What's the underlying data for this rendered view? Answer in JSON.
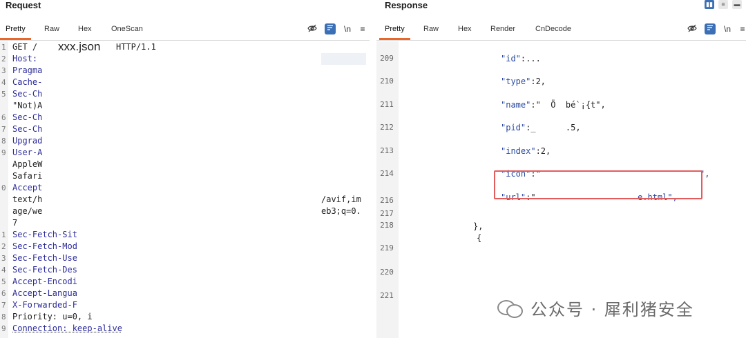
{
  "request": {
    "title": "Request",
    "tabs": [
      "Pretty",
      "Raw",
      "Hex",
      "OneScan"
    ],
    "line_numbers": [
      "1",
      "2",
      "3",
      "4",
      "5",
      "",
      "6",
      "7",
      "8",
      "9",
      "",
      "",
      "0",
      "",
      "",
      "",
      "1",
      "2",
      "3",
      "4",
      "5",
      "6",
      "7",
      "8",
      "9"
    ],
    "lines": [
      {
        "text": "GET /",
        "kind": "val"
      },
      {
        "text": "Host:",
        "kind": "hdr"
      },
      {
        "text": "Pragma",
        "kind": "hdr"
      },
      {
        "text": "Cache-",
        "kind": "hdr"
      },
      {
        "text": "Sec-Ch",
        "kind": "hdr"
      },
      {
        "text": "\"Not)A",
        "kind": "val"
      },
      {
        "text": "Sec-Ch",
        "kind": "hdr"
      },
      {
        "text": "Sec-Ch",
        "kind": "hdr"
      },
      {
        "text": "Upgrad",
        "kind": "hdr"
      },
      {
        "text": "User-A",
        "kind": "hdr"
      },
      {
        "text": "AppleW",
        "kind": "val"
      },
      {
        "text": "Safari",
        "kind": "val"
      },
      {
        "text": "Accept",
        "kind": "hdr"
      },
      {
        "text": "text/h",
        "kind": "val"
      },
      {
        "text": "age/we",
        "kind": "val"
      },
      {
        "text": "7",
        "kind": "val"
      },
      {
        "text": "Sec-Fetch-Sit",
        "kind": "hdr"
      },
      {
        "text": "Sec-Fetch-Mod",
        "kind": "hdr"
      },
      {
        "text": "Sec-Fetch-Use",
        "kind": "hdr"
      },
      {
        "text": "Sec-Fetch-Des",
        "kind": "hdr"
      },
      {
        "text": "Accept-Encodi",
        "kind": "hdr"
      },
      {
        "text": "Accept-Langua",
        "kind": "hdr"
      },
      {
        "text": "X-Forwarded-F",
        "kind": "hdr"
      },
      {
        "text": "Priority: u=0, i",
        "kind": "val"
      },
      {
        "text": "Connection: keep-alive",
        "kind": "hdr"
      }
    ],
    "filename": "xxx.json",
    "http_version": "HTTP/1.1",
    "accept_tail_1": "/avif,im",
    "accept_tail_2": "eb3;q=0."
  },
  "response": {
    "title": "Response",
    "tabs": [
      "Pretty",
      "Raw",
      "Hex",
      "Render",
      "CnDecode"
    ],
    "rows": [
      {
        "ln": "209",
        "key": "\"id\"",
        "rest": ":..."
      },
      {
        "ln": "210",
        "key": "\"type\"",
        "rest": ":2,"
      },
      {
        "ln": "211",
        "key": "\"name\"",
        "rest": ":\"  Ö  bé`¡{t\","
      },
      {
        "ln": "212",
        "key": "\"pid\"",
        "rest": ":_      .5,"
      },
      {
        "ln": "213",
        "key": "\"index\"",
        "rest": ":2,"
      },
      {
        "ln": "214",
        "key": "\"icon\"",
        "rest": ":\"",
        "tail": "\","
      },
      {
        "ln": "",
        "key": "\"url\"",
        "rest": ":\"",
        "tail": "e.html\","
      },
      {
        "ln": "216",
        "key": "",
        "rest": ""
      },
      {
        "ln": "217",
        "key": "",
        "rest": "},"
      },
      {
        "ln": "218",
        "key": "",
        "rest": "{"
      },
      {
        "ln": "219",
        "key": "",
        "rest": ""
      },
      {
        "ln": "220",
        "key": "",
        "rest": ""
      },
      {
        "ln": "221",
        "key": "",
        "rest": ""
      }
    ]
  },
  "watermark": "公众号 · 犀利猪安全",
  "icons": {
    "eye_off": "eye-off-icon",
    "wrap": "wrap-lines-icon",
    "newline": "newline-toggle-icon",
    "menu": "menu-icon",
    "layout_split": "layout-split-icon",
    "layout_horizontal": "layout-horizontal-icon",
    "layout_single": "layout-single-icon"
  },
  "colors": {
    "accent": "#e8682b",
    "highlight": "#e35c5c",
    "blue": "#3b6fb6"
  }
}
